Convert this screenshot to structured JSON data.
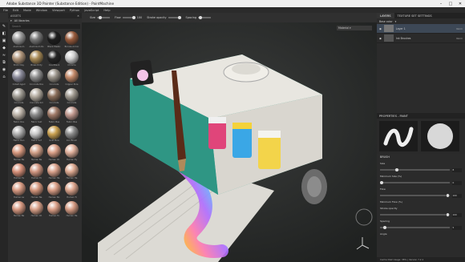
{
  "window": {
    "title": "Adobe Substance 3D Painter (Substance Edition) - PaintMachine"
  },
  "menu": [
    "File",
    "Edit",
    "Mode",
    "Window",
    "Viewport",
    "Python",
    "JavaScript",
    "Help"
  ],
  "toolbar": {
    "size_label": "Size",
    "flow_label": "Flow",
    "flow_value": "100",
    "opacity_label": "Stroke opacity",
    "spacing_label": "Spacing"
  },
  "shelf": {
    "title": "ASSETS",
    "close": "✕",
    "library": "All libraries",
    "search_placeholder": "Search",
    "materials": [
      {
        "label": "Aluminium",
        "color": "#9a9a9a"
      },
      {
        "label": "Aluminium Ro",
        "color": "#777"
      },
      {
        "label": "Black Plastic",
        "color": "#1d1d1d"
      },
      {
        "label": "Bronze Armor",
        "color": "#9a5c3d"
      },
      {
        "label": "Brick Clay",
        "color": "#b0957a"
      },
      {
        "label": "Brass Dirty",
        "color": "#a88a55"
      },
      {
        "label": "Coal Black",
        "color": "#242424"
      },
      {
        "label": "Chrome",
        "color": "#cfcfcf"
      },
      {
        "label": "Cobalt Aged",
        "color": "#8a8a9a"
      },
      {
        "label": "Concrete Rou",
        "color": "#8f8f8f"
      },
      {
        "label": "Concrete",
        "color": "#9a948a"
      },
      {
        "label": "Copper Pure",
        "color": "#c48a6a"
      },
      {
        "label": "Concrete",
        "color": "#a09c94"
      },
      {
        "label": "Concrete Sm",
        "color": "#b4aca0"
      },
      {
        "label": "Concrete",
        "color": "#8a6e5a"
      },
      {
        "label": "Concrete",
        "color": "#a09a90"
      },
      {
        "label": "Fabric Rou",
        "color": "#bcb3a8"
      },
      {
        "label": "Fabric Suit",
        "color": "#8a8a8a"
      },
      {
        "label": "Fabric Bas",
        "color": "#a07a68"
      },
      {
        "label": "Fabric Bas",
        "color": "#c29a90"
      },
      {
        "label": "Fabric Den",
        "color": "#aeaeae"
      },
      {
        "label": "Fabric Sof",
        "color": "#c8c8c8"
      },
      {
        "label": "Gold Pure",
        "color": "#c9a050"
      },
      {
        "label": "Iron Brush",
        "color": "#8a8a8a"
      },
      {
        "label": "Human Ba",
        "color": "#d99a80"
      },
      {
        "label": "Human Be",
        "color": "#d4a28a"
      },
      {
        "label": "Human Ch",
        "color": "#dba088"
      },
      {
        "label": "Human Ey",
        "color": "#e0b09c"
      },
      {
        "label": "Human Fe",
        "color": "#d68f78"
      },
      {
        "label": "Human Fo",
        "color": "#cf9580"
      },
      {
        "label": "Human Ha",
        "color": "#d8a08a"
      },
      {
        "label": "Human Ha",
        "color": "#dca890"
      },
      {
        "label": "Human Le",
        "color": "#d89a82"
      },
      {
        "label": "Human Ne",
        "color": "#d4967c"
      },
      {
        "label": "Human No",
        "color": "#d99d85"
      },
      {
        "label": "Human Ti",
        "color": "#dba48c"
      },
      {
        "label": "Human Ba",
        "color": "#d69880"
      },
      {
        "label": "Human Ch",
        "color": "#d8a088"
      },
      {
        "label": "Human Fo",
        "color": "#da9e86"
      },
      {
        "label": "Human Ha",
        "color": "#d49a82"
      }
    ]
  },
  "viewport": {
    "mode": "Material"
  },
  "right": {
    "tabs": [
      "LAYERS",
      "TEXTURE SET SETTINGS"
    ],
    "channel": "Base color",
    "layers": [
      {
        "name": "Layer 1",
        "blend": "Norm",
        "opacity": "100",
        "selected": true
      },
      {
        "name": "Ink Brushes",
        "blend": "Norm",
        "opacity": "100",
        "selected": false
      }
    ],
    "props_title": "PROPERTIES - PAINT",
    "brush_section": "BRUSH",
    "size_label": "Size",
    "size_value": "8",
    "minsize_label": "Minimum Size (%)",
    "minsize_value": "0",
    "flow_label": "Flow",
    "flow_value": "100",
    "minflow_label": "Minimum Flow (%)",
    "stroke_opacity_label": "Stroke opacity",
    "stroke_opacity_value": "100",
    "spacing_label": "Spacing",
    "spacing_value": "5",
    "angle_label": "Angle",
    "status": "Cache Disk Usage: 38% | Version 7.2.1"
  }
}
